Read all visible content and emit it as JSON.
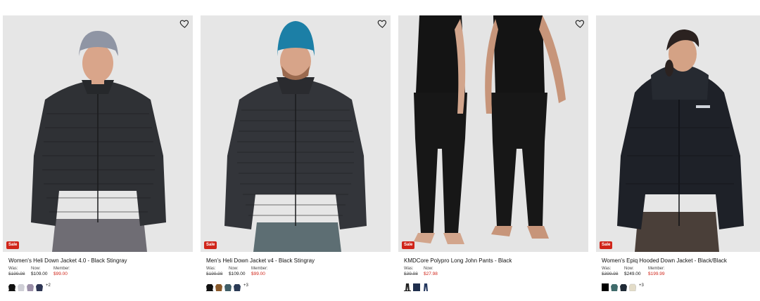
{
  "products": [
    {
      "title": "Women's Heli Down Jacket 4.0 - Black Stingray",
      "badge": "Sale",
      "was_label": "Was:",
      "was_price": "$199.98",
      "now_label": "Now:",
      "now_price": "$109.00",
      "member_label": "Member:",
      "member_price": "$99.00",
      "swatches": [
        "#111111",
        "#cfcfd6",
        "#9b8fa8",
        "#2d3553"
      ],
      "more": "+2"
    },
    {
      "title": "Men's Heli Down Jacket v4 - Black Stingray",
      "badge": "Sale",
      "was_label": "Was:",
      "was_price": "$199.98",
      "now_label": "Now:",
      "now_price": "$109.00",
      "member_label": "Member:",
      "member_price": "$99.00",
      "swatches": [
        "#111111",
        "#8a5a2b",
        "#3f5d66",
        "#2a3a55"
      ],
      "more": "+3"
    },
    {
      "title": "KMDCore Polypro Long John Pants - Black",
      "badge": "Sale",
      "was_label": "Was:",
      "was_price": "$39.98",
      "now_label": "Now:",
      "now_price": "$27.98",
      "swatches": [
        "#222222",
        "#1f2f4d",
        "#24375e"
      ]
    },
    {
      "title": "Women's Epiq Hooded Down Jacket - Black/Black",
      "badge": "Sale",
      "was_label": "Was:",
      "was_price": "$399.98",
      "now_label": "Now:",
      "now_price": "$249.00",
      "member_label": "Member:",
      "member_price": "$199.99",
      "swatches": [
        "#000000",
        "#3f6b6b",
        "#1f2a36",
        "#e3dcc8"
      ],
      "more": "+3"
    }
  ],
  "colors": {
    "sale": "#d0251a",
    "image_bg": "#e6e6e6"
  },
  "icons": {
    "wishlist": "heart-icon"
  }
}
